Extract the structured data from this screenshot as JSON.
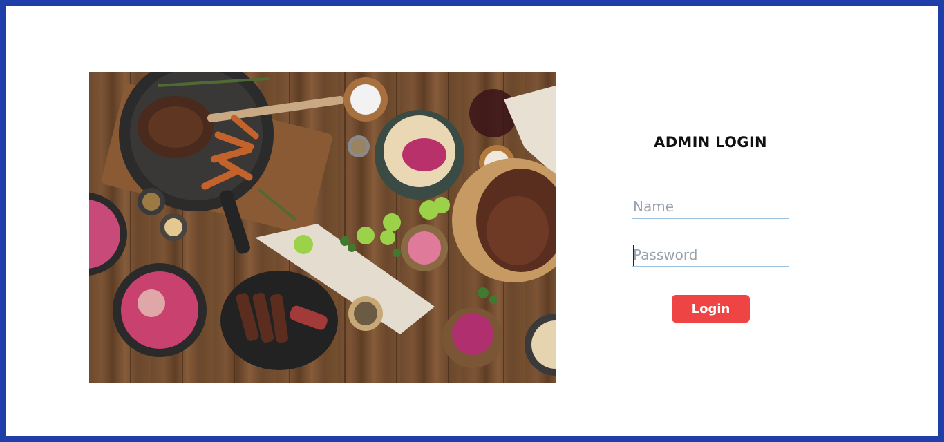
{
  "login": {
    "title": "ADMIN LOGIN",
    "name_placeholder": "Name",
    "name_value": "",
    "password_placeholder": "Password",
    "password_value": "",
    "button_label": "Login"
  },
  "colors": {
    "frame_border": "#1e3eaa",
    "button_bg": "#ef4444",
    "input_underline": "#9cc2df"
  },
  "image": {
    "subject": "food-spread-photo"
  }
}
